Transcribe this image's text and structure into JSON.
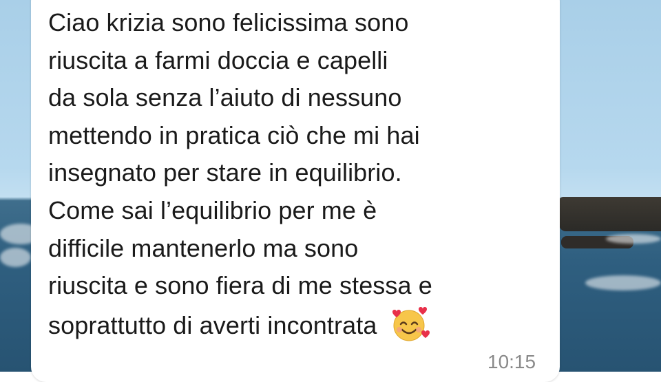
{
  "chat": {
    "message_lines": [
      "Ciao krizia sono felicissima sono",
      "riuscita a farmi doccia e capelli",
      "da sola senza l’aiuto di nessuno",
      "mettendo in pratica ciò che mi hai",
      "insegnato per stare in equilibrio.",
      "Come sai l’equilibrio per me è",
      "difficile mantenerlo ma sono",
      "riuscita e sono fiera di me stessa e",
      "soprattutto di averti incontrata"
    ],
    "emoji_icon": "smiling-face-with-hearts-emoji",
    "time": "10:15"
  },
  "colors": {
    "bubble": "#ffffff",
    "text": "#1a1a1a",
    "timestamp": "#8a8a8a",
    "sky": "#b6d8ee",
    "sea": "#2f5f80"
  }
}
